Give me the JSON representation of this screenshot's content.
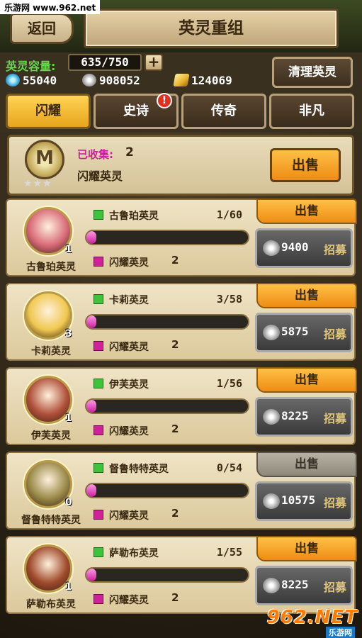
{
  "watermark": {
    "site": "乐游网 www.962.net",
    "logo_big": "962.NET",
    "logo_small": "乐游网"
  },
  "header": {
    "back_label": "返回",
    "title": "英灵重组"
  },
  "info": {
    "capacity_label": "英灵容量:",
    "capacity_value": "635/750",
    "plus": "+",
    "crystal": "55040",
    "silver": "908052",
    "gold": "124069",
    "clean_label": "清理英灵"
  },
  "tabs": [
    {
      "label": "闪耀",
      "active": true
    },
    {
      "label": "史诗",
      "badge": "!"
    },
    {
      "label": "传奇"
    },
    {
      "label": "非凡"
    }
  ],
  "summary": {
    "medal_glyph": "M",
    "stars": "★★★",
    "collected_label": "已收集:",
    "collected_count": "2",
    "name": "闪耀英灵",
    "sell_label": "出售"
  },
  "cards": [
    {
      "name": "古鲁珀英灵",
      "level": "1",
      "shard_label": "古鲁珀英灵",
      "fraction": "1/60",
      "progress": 0.017,
      "shine_label": "闪耀英灵",
      "shine_count": "2",
      "sell_label": "出售",
      "sell_enabled": true,
      "price": "9400",
      "recruit_label": "招募",
      "portrait_color": "#d86a78"
    },
    {
      "name": "卡莉英灵",
      "level": "3",
      "shard_label": "卡莉英灵",
      "fraction": "3/58",
      "progress": 0.052,
      "shine_label": "闪耀英灵",
      "shine_count": "2",
      "sell_label": "出售",
      "sell_enabled": true,
      "price": "5875",
      "recruit_label": "招募",
      "portrait_color": "#f0c850"
    },
    {
      "name": "伊芙英灵",
      "level": "1",
      "shard_label": "伊芙英灵",
      "fraction": "1/56",
      "progress": 0.018,
      "shine_label": "闪耀英灵",
      "shine_count": "2",
      "sell_label": "出售",
      "sell_enabled": true,
      "price": "8225",
      "recruit_label": "招募",
      "portrait_color": "#b0503a"
    },
    {
      "name": "督鲁特特英灵",
      "level": "0",
      "shard_label": "督鲁特特英灵",
      "fraction": "0/54",
      "progress": 0.0,
      "shine_label": "闪耀英灵",
      "shine_count": "2",
      "sell_label": "出售",
      "sell_enabled": false,
      "price": "10575",
      "recruit_label": "招募",
      "portrait_color": "#9a8a48"
    },
    {
      "name": "萨勒布英灵",
      "level": "1",
      "shard_label": "萨勒布英灵",
      "fraction": "1/55",
      "progress": 0.018,
      "shine_label": "闪耀英灵",
      "shine_count": "2",
      "sell_label": "出售",
      "sell_enabled": true,
      "price": "8225",
      "recruit_label": "招募",
      "portrait_color": "#a04a2c"
    }
  ]
}
